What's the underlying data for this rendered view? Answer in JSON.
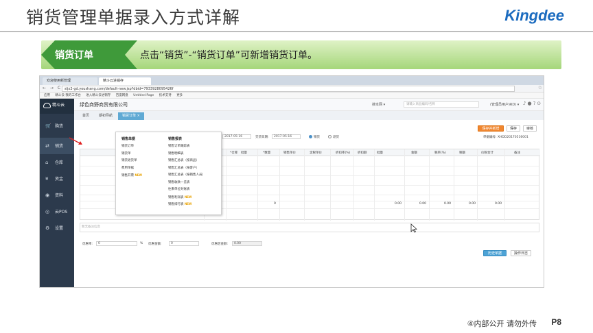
{
  "slide": {
    "title": "销货管理单据录入方式详解",
    "brand": "Kingdee",
    "banner_label": "销货订单",
    "banner_text": "点击“销货”-“销货订单”可新增销货订单。",
    "footer": "④内部公开 请勿外传",
    "page": "P8"
  },
  "browser": {
    "tabs": [
      "欢迎使用新管理",
      "精斗云进销存"
    ],
    "url": "sljx2-gd.youshang.com/default-new.jsp?dbid=7933928095426f",
    "bookmarks": [
      "应用",
      "精斗云·我的工作台",
      "进入精斗云进销存",
      "百度网盘",
      "Untitled Page",
      "技术支持",
      "更多"
    ]
  },
  "app": {
    "logo": "精斗云",
    "company": "绿色商野商贸有限公司",
    "top": {
      "scope_select": "搜本网 ▾",
      "search_placeholder": "请输入商品编码/名称",
      "user": "(管理员用户)RD) ▾"
    },
    "sidebar": [
      {
        "label": "购货",
        "icon": "cart-icon"
      },
      {
        "label": "销货",
        "icon": "sales-icon"
      },
      {
        "label": "仓库",
        "icon": "warehouse-icon"
      },
      {
        "label": "资金",
        "icon": "money-icon"
      },
      {
        "label": "资料",
        "icon": "data-icon"
      },
      {
        "label": "云POS",
        "icon": "pos-icon"
      },
      {
        "label": "设置",
        "icon": "settings-icon"
      }
    ],
    "tabs": [
      "首页",
      "期初导航",
      "销货订单 ×"
    ],
    "buttons": {
      "save_new": "保存并新增",
      "save": "保存",
      "audit": "审核",
      "history": "历史单据",
      "log": "操作日志"
    },
    "form": {
      "date_label": "单据日期:",
      "date_value": "2017-05-16",
      "delivery_label": "交货日期:",
      "delivery_value": "2017-05-16",
      "sale_label": "销货",
      "return_label": "退货",
      "bill_no": "单据编号: XHDD20170516001",
      "memo_placeholder": "暂无备注信息",
      "discount_rate_label": "优惠率:",
      "discount_rate_value": "0",
      "discount_pct": "%",
      "discount_amt_label": "优惠金额:",
      "discount_amt_value": "0",
      "after_discount_label": "优惠后金额:",
      "after_discount_value": "0.00"
    },
    "grid": {
      "columns": [
        "单位",
        "*仓库",
        "批量",
        "*数量",
        "销售单价",
        "含税单价",
        "折扣率(%)",
        "折扣额",
        "批量",
        "金额",
        "税率(%)",
        "税额",
        "价税合计",
        "备注"
      ],
      "totals": [
        "0",
        "0.00",
        "0.00",
        "0.00",
        "0.00",
        "0.00"
      ]
    },
    "menu": {
      "col1_head": "销售单据",
      "col1": [
        "销货订单",
        "销货单",
        "销货退货单",
        "费用单据",
        "销售开票"
      ],
      "col2_head": "销售报表",
      "col2": [
        "销售订单跟踪表",
        "销售明细表",
        "销售汇总表（按商品）",
        "销售汇总表（按客户）",
        "销售汇总表（按销售人员）",
        "销售收款一览表",
        "往来单位对账表",
        "销售利润表",
        "销售排行表"
      ],
      "new_tag": "NEW"
    }
  },
  "colors": {
    "banner_dark": "#3f9a3a",
    "banner_light": "#a5d67a",
    "brand_blue": "#1b6bbf",
    "sidebar_bg": "#2c3a4c",
    "accent_orange": "#f0862f"
  }
}
